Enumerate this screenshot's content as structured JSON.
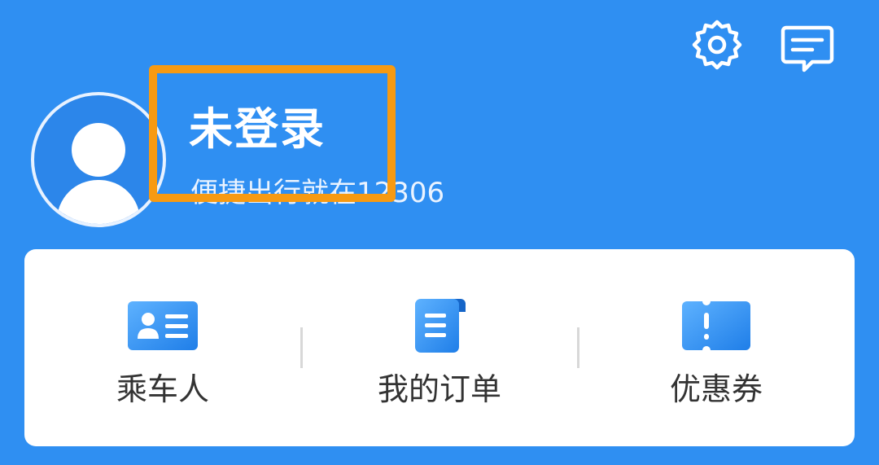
{
  "header": {
    "settings_icon": "gear-icon",
    "message_icon": "message-icon"
  },
  "profile": {
    "avatar_icon": "default-avatar-icon",
    "title": "未登录",
    "subtitle": "便捷出行就在12306"
  },
  "shortcuts": [
    {
      "label": "乘车人",
      "icon": "passenger-card-icon"
    },
    {
      "label": "我的订单",
      "icon": "order-document-icon"
    },
    {
      "label": "优惠券",
      "icon": "ticket-coupon-icon"
    }
  ],
  "colors": {
    "background": "#2f8ff2",
    "highlight": "#f79a12",
    "card": "#ffffff",
    "icon_blue": "#2b8cf0"
  }
}
